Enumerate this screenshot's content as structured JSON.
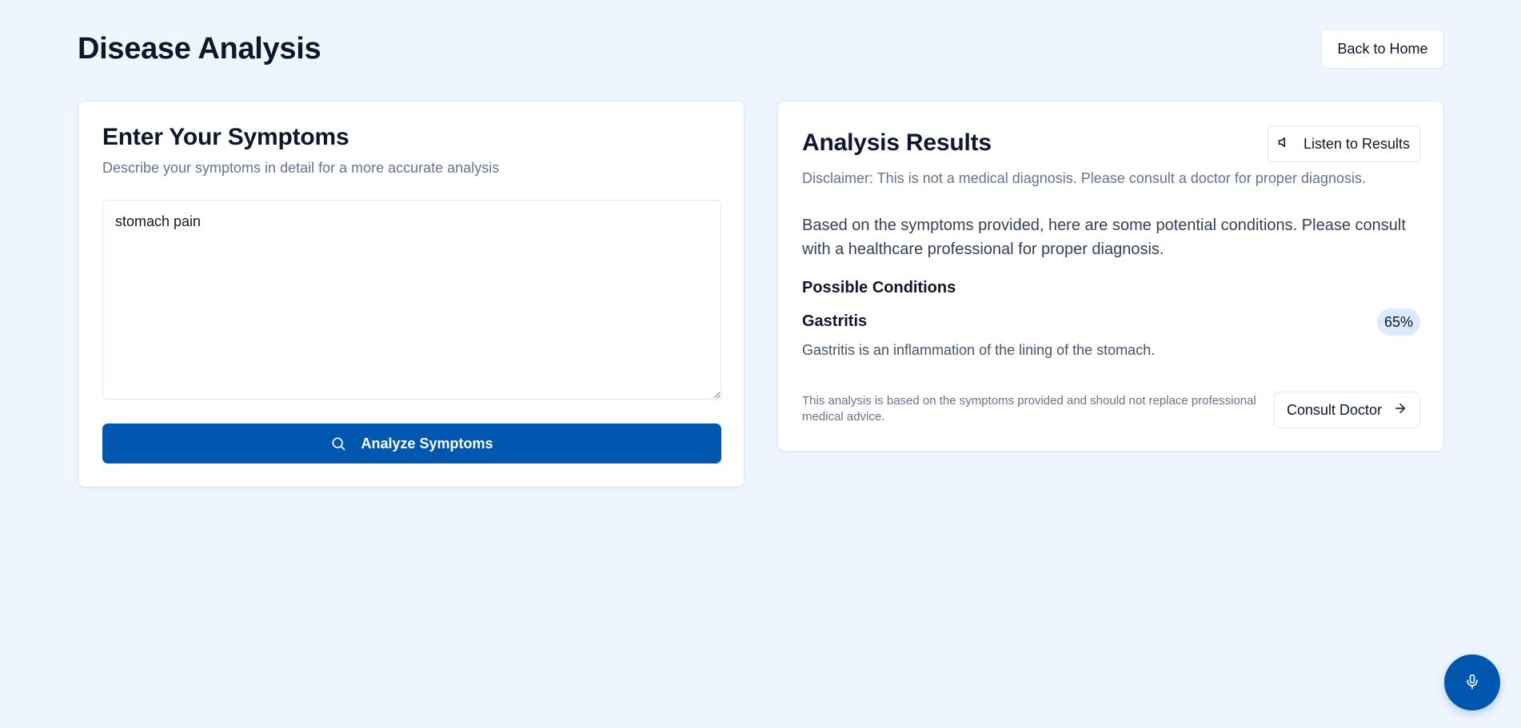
{
  "page": {
    "title": "Disease Analysis",
    "back_button": "Back to Home"
  },
  "symptoms_card": {
    "title": "Enter Your Symptoms",
    "subtitle": "Describe your symptoms in detail for a more accurate analysis",
    "input_value": "stomach pain",
    "analyze_button": "Analyze Symptoms",
    "analyze_icon": "search-icon"
  },
  "results_card": {
    "title": "Analysis Results",
    "listen_button": "Listen to Results",
    "listen_icon": "speaker-icon",
    "disclaimer": "Disclaimer: This is not a medical diagnosis. Please consult a doctor for proper diagnosis.",
    "summary": "Based on the symptoms provided, here are some potential conditions. Please consult with a healthcare professional for proper diagnosis.",
    "conditions_heading": "Possible Conditions",
    "conditions": [
      {
        "name": "Gastritis",
        "probability": "65%",
        "description": "Gastritis is an inflammation of the lining of the stomach."
      }
    ],
    "footer_note": "This analysis is based on the symptoms provided and should not replace professional medical advice.",
    "consult_button": "Consult Doctor",
    "consult_icon": "arrow-right-icon"
  },
  "mic_button": {
    "icon": "microphone-icon"
  },
  "colors": {
    "background": "#eef5fe",
    "primary": "#0057b0",
    "badge": "#dbeafe",
    "muted_text": "#64748b"
  }
}
